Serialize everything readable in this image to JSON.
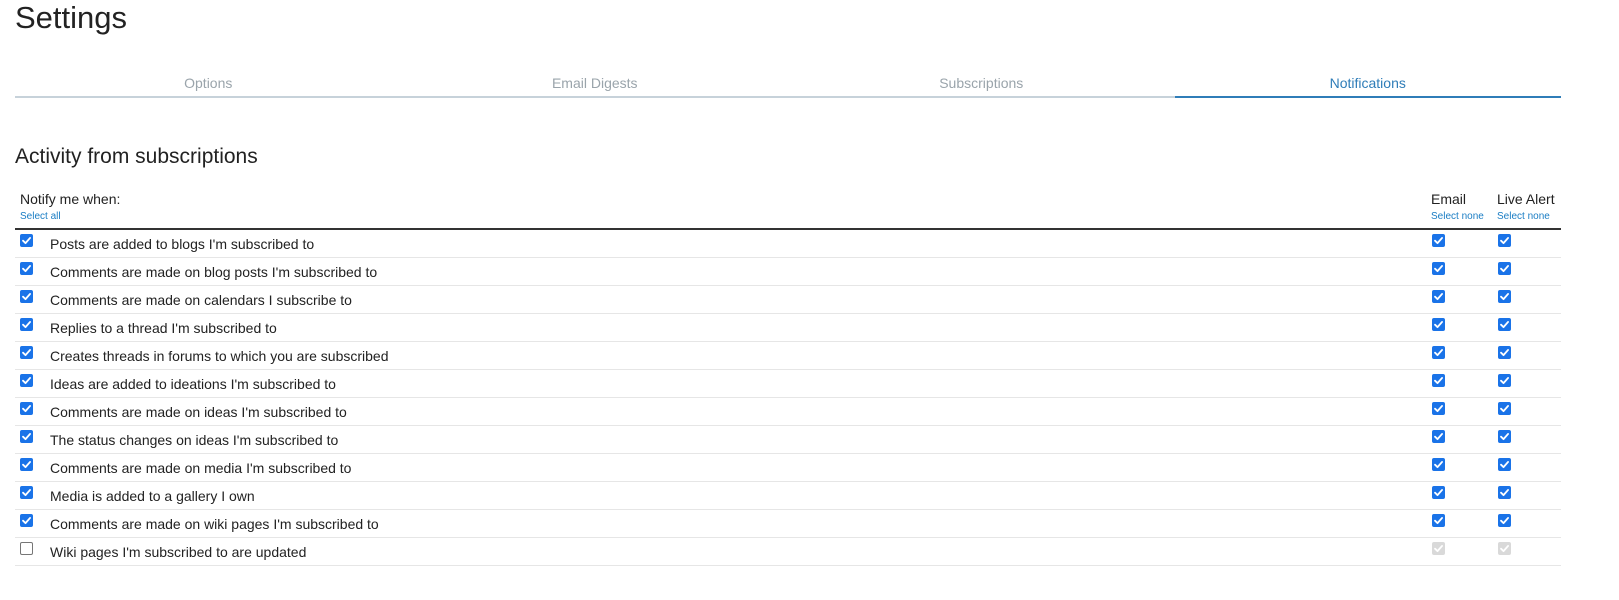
{
  "page": {
    "title": "Settings"
  },
  "tabs": [
    {
      "label": "Options",
      "active": false
    },
    {
      "label": "Email Digests",
      "active": false
    },
    {
      "label": "Subscriptions",
      "active": false
    },
    {
      "label": "Notifications",
      "active": true
    }
  ],
  "section": {
    "title": "Activity from subscriptions",
    "header": {
      "label": "Notify me when:",
      "select_all": "Select all",
      "email_label": "Email",
      "email_select_none": "Select none",
      "alert_label": "Live Alert",
      "alert_select_none": "Select none"
    },
    "rows": [
      {
        "label": "Posts are added to blogs I'm subscribed to",
        "enabled": true,
        "email": true,
        "alert": true
      },
      {
        "label": "Comments are made on blog posts I'm subscribed to",
        "enabled": true,
        "email": true,
        "alert": true
      },
      {
        "label": "Comments are made on calendars I subscribe to",
        "enabled": true,
        "email": true,
        "alert": true
      },
      {
        "label": "Replies to a thread I'm subscribed to",
        "enabled": true,
        "email": true,
        "alert": true
      },
      {
        "label": "Creates threads in forums to which you are subscribed",
        "enabled": true,
        "email": true,
        "alert": true
      },
      {
        "label": "Ideas are added to ideations I'm subscribed to",
        "enabled": true,
        "email": true,
        "alert": true
      },
      {
        "label": "Comments are made on ideas I'm subscribed to",
        "enabled": true,
        "email": true,
        "alert": true
      },
      {
        "label": "The status changes on ideas I'm subscribed to",
        "enabled": true,
        "email": true,
        "alert": true
      },
      {
        "label": "Comments are made on media I'm subscribed to",
        "enabled": true,
        "email": true,
        "alert": true
      },
      {
        "label": "Media is added to a gallery I own",
        "enabled": true,
        "email": true,
        "alert": true
      },
      {
        "label": "Comments are made on wiki pages I'm subscribed to",
        "enabled": true,
        "email": true,
        "alert": true
      },
      {
        "label": "Wiki pages I'm subscribed to are updated",
        "enabled": false,
        "email": true,
        "alert": true
      }
    ]
  },
  "colors": {
    "accent": "#2f7db8",
    "link": "#1a7dc4",
    "checkbox_checked": "#1a73e8",
    "checkbox_disabled": "#d9d9d9"
  }
}
